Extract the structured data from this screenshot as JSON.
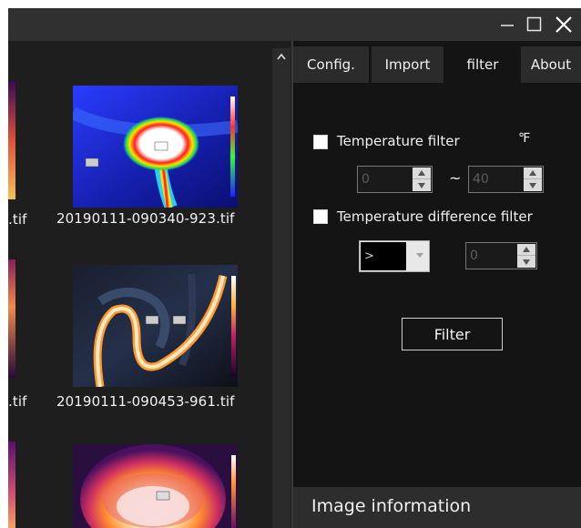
{
  "window": {
    "controls": {
      "minimize_icon": "minimize-icon",
      "maximize_icon": "maximize-icon",
      "close_icon": "close-icon"
    }
  },
  "gallery": {
    "partial_labels": [
      ".tif",
      ".tif"
    ],
    "items": [
      {
        "label": "20190111-090340-923.tif"
      },
      {
        "label": "20190111-090453-961.tif"
      },
      {
        "label": ""
      }
    ]
  },
  "tabs": [
    {
      "label": "Config.",
      "active": false
    },
    {
      "label": "Import",
      "active": false
    },
    {
      "label": "filter",
      "active": true
    },
    {
      "label": "About",
      "active": false
    }
  ],
  "filter": {
    "temperature_filter": {
      "label": "Temperature filter",
      "checked": false,
      "unit": "℉",
      "min_value": "0",
      "max_value": "40",
      "range_separator": "~"
    },
    "difference_filter": {
      "label": "Temperature difference filter",
      "checked": false,
      "operator": ">",
      "value": "0"
    },
    "button_label": "Filter"
  },
  "image_information": {
    "title": "Image information"
  },
  "colors": {
    "titlebar": "#303030",
    "panel_bg": "#141414",
    "tab_bg": "#2b2b2b",
    "info_bar": "#2d2d2d"
  }
}
